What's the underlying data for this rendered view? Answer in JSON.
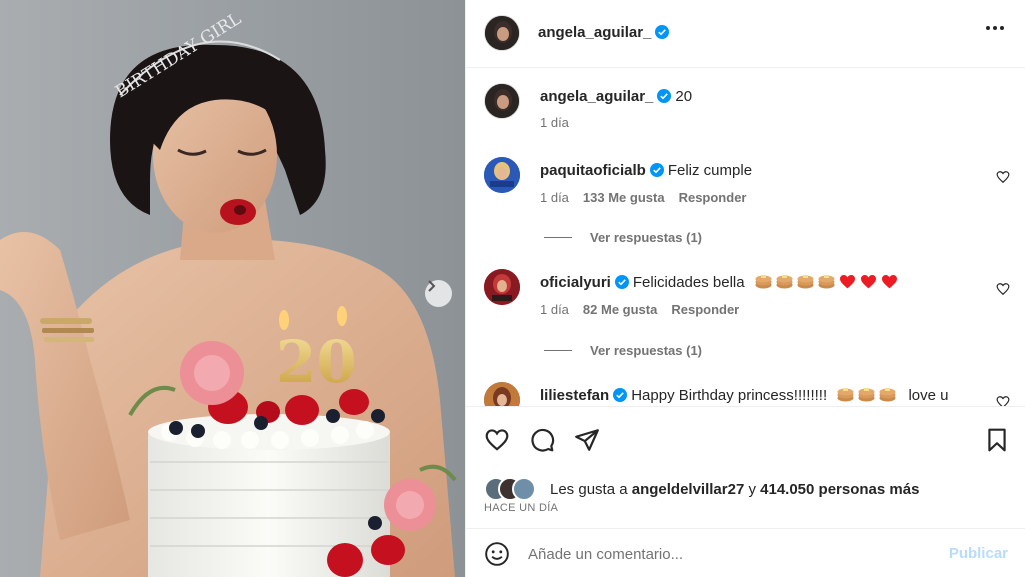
{
  "post": {
    "username": "angela_aguilar_",
    "more_icon": "more-horizontal-icon",
    "caption": {
      "username": "angela_aguilar_",
      "text": "20",
      "time": "1 día"
    },
    "headband_text": "BIRTHDAY GIRL",
    "cake_number": "20"
  },
  "comments": [
    {
      "username": "paquitaoficialb",
      "text": "Feliz cumple",
      "time": "1 día",
      "likes": "133 Me gusta",
      "reply": "Responder",
      "view_replies": "Ver respuestas (1)",
      "avatar_color": "#2a59b8"
    },
    {
      "username": "oficialyuri",
      "text": "Felicidades bella",
      "time": "1 día",
      "likes": "82 Me gusta",
      "reply": "Responder",
      "view_replies": "Ver respuestas (1)",
      "avatar_color": "#b3262a"
    },
    {
      "username": "liliestefan",
      "text": "Happy Birthday princess!!!!!!!!",
      "text_after": "love u",
      "avatar_color": "#a05238"
    }
  ],
  "likes": {
    "prefix": "Les gusta a",
    "user": "angeldelvillar27",
    "connector": "y",
    "count": "414.050 personas más"
  },
  "timestamp": "HACE UN DÍA",
  "comment_box": {
    "placeholder": "Añade un comentario...",
    "publish": "Publicar"
  },
  "colors": {
    "verified": "#0095f6",
    "heart_red": "#ed1c24",
    "publish_disabled": "#b8dcfc"
  }
}
